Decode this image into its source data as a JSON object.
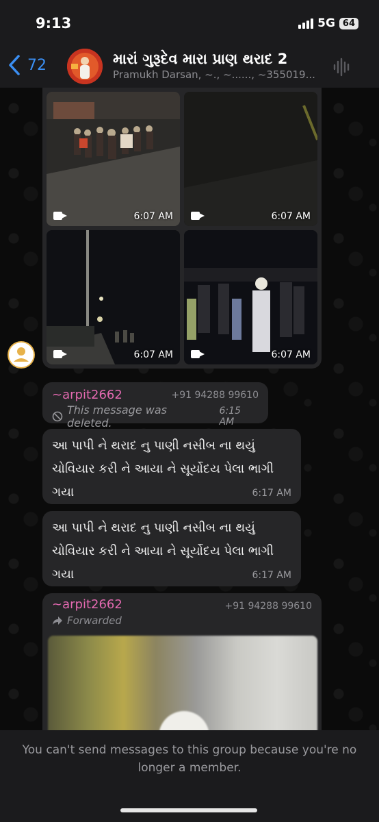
{
  "status_bar": {
    "time": "9:13",
    "network": "5G",
    "battery": "64"
  },
  "header": {
    "back_count": "72",
    "title": "મારાં ગુરૂદેવ મારા પ્રાણ થરાદ 2",
    "subtitle": "Pramukh Darsan, ~., ~......, ~355019..."
  },
  "media_album": {
    "videos": [
      {
        "time": "6:07 AM"
      },
      {
        "time": "6:07 AM"
      },
      {
        "time": "6:07 AM"
      },
      {
        "time": "6:07 AM"
      }
    ]
  },
  "messages": [
    {
      "sender": "~arpit2662",
      "phone": "+91 94288 99610",
      "deleted_text": "This message was deleted.",
      "time": "6:15 AM"
    },
    {
      "text_line1": "આ પાપી ને થરાદ નુ પાણી નસીબ ના થયું",
      "text_line2": "ચોવિયાર કરી ને આયા ને સૂર્યોદય પેલા ભાગી",
      "text_line3": "ગયા",
      "time": "6:17 AM"
    },
    {
      "text_line1": "આ પાપી ને થરાદ નુ પાણી નસીબ ના થયું",
      "text_line2": "ચોવિયાર કરી ને આયા ને સૂર્યોદય પેલા ભાગી",
      "text_line3": "ગયા",
      "time": "6:17 AM"
    },
    {
      "sender": "~arpit2662",
      "phone": "+91 94288 99610",
      "forwarded_label": "Forwarded"
    }
  ],
  "footer": {
    "message": "You can't send messages to this group because you're no longer a member."
  },
  "colors": {
    "accent": "#3b8ff3",
    "sender": "#e46ab1",
    "bubble": "#262628"
  }
}
